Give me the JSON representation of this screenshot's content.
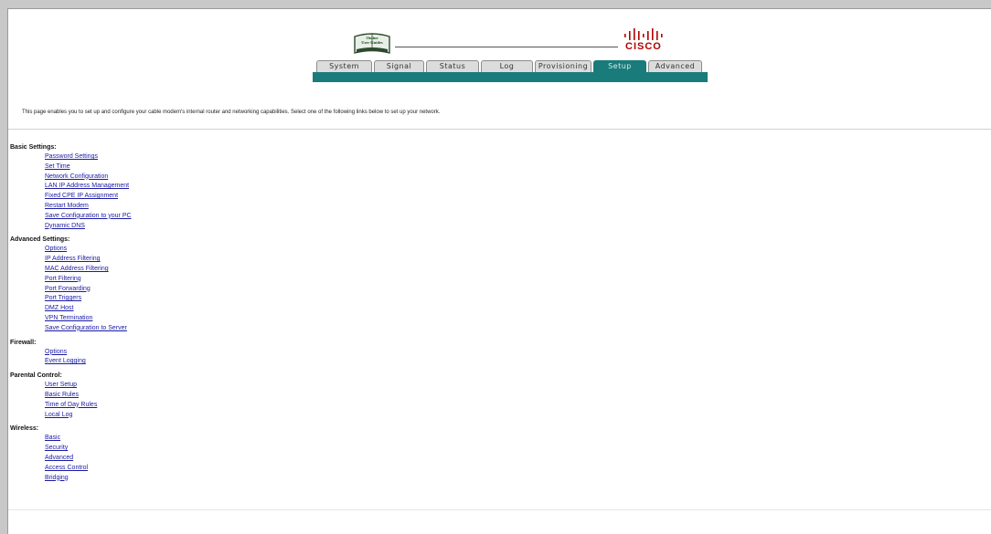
{
  "header": {
    "logo_text": [
      "Online",
      "User Guides"
    ],
    "brand": "CISCO"
  },
  "tabs": [
    {
      "label": "System",
      "active": false
    },
    {
      "label": "Signal",
      "active": false
    },
    {
      "label": "Status",
      "active": false
    },
    {
      "label": "Log",
      "active": false
    },
    {
      "label": "Provisioning",
      "active": false
    },
    {
      "label": "Setup",
      "active": true
    },
    {
      "label": "Advanced",
      "active": false
    }
  ],
  "intro": "This page enables you to set up and configure your cable modem's internal router and networking capabilities.  Select one of the following links below to set up your network.",
  "sections": [
    {
      "title": "Basic Settings:",
      "links": [
        "Password Settings",
        "Set Time",
        "Network Configuration",
        "LAN IP Address Management",
        "Fixed CPE IP Assignment",
        "Restart Modem",
        "Save Configuration to your PC",
        "Dynamic DNS"
      ]
    },
    {
      "title": "Advanced Settings:",
      "links": [
        "Options",
        "IP Address Filtering",
        "MAC Address Filtering",
        "Port Filtering",
        "Port Forwarding",
        "Port Triggers",
        "DMZ Host",
        "VPN Termination",
        "Save Configuration to Server"
      ]
    },
    {
      "title": "Firewall:",
      "links": [
        "Options",
        "Event Logging"
      ]
    },
    {
      "title": "Parental Control:",
      "links": [
        "User Setup",
        "Basic Rules",
        "Time of Day Rules",
        "Local Log"
      ]
    },
    {
      "title": "Wireless:",
      "links": [
        "Basic",
        "Security",
        "Advanced",
        "Access Control",
        "Bridging"
      ]
    }
  ],
  "colors": {
    "accent": "#1a7b7b",
    "link": "#1a1aa6",
    "brand": "#b00000"
  }
}
